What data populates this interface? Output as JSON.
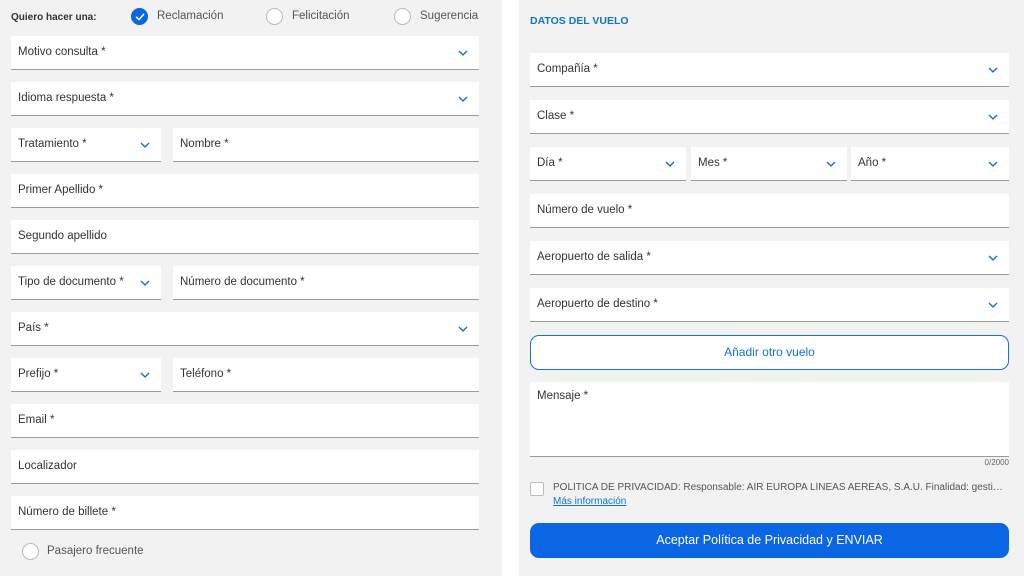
{
  "contact_type": {
    "question": "Quiero hacer una:",
    "options": [
      {
        "label": "Reclamación",
        "selected": true
      },
      {
        "label": "Felicitación",
        "selected": false
      },
      {
        "label": "Sugerencia",
        "selected": false
      }
    ]
  },
  "personal": {
    "motivo": "Motivo consulta *",
    "idioma": "Idioma respuesta *",
    "tratamiento": "Tratamiento *",
    "nombre": "Nombre *",
    "primer_apellido": "Primer Apellido *",
    "segundo_apellido": "Segundo apellido",
    "tipo_documento": "Tipo de documento *",
    "numero_documento": "Número de documento *",
    "pais": "País *",
    "prefijo": "Prefijo *",
    "telefono": "Teléfono *",
    "email": "Email *",
    "localizador": "Localizador",
    "numero_billete": "Número de billete *",
    "pasajero_frecuente": "Pasajero frecuente"
  },
  "flight": {
    "title": "DATOS DEL VUELO",
    "compania": "Compañía *",
    "clase": "Clase *",
    "dia": "Día *",
    "mes": "Mes *",
    "anio": "Año *",
    "numero_vuelo": "Número de vuelo *",
    "aeropuerto_salida": "Aeropuerto de salida *",
    "aeropuerto_destino": "Aeropuerto de destino *",
    "add_flight": "Añadir otro vuelo",
    "mensaje": "Mensaje *",
    "counter": "0/2000",
    "privacy_text": "POLÍTICA DE PRIVACIDAD: Responsable: AIR EUROPA LÍNEAS AÉREAS, S.A.U. Finalidad: gestionar...",
    "privacy_more": "Más información",
    "submit": "Aceptar Política de Privacidad y ENVIAR"
  },
  "colors": {
    "accent": "#0a66e4",
    "title_blue": "#1176c8",
    "panel_bg": "#f2f2f2"
  },
  "icons": {
    "dropdown": "chevron-down-icon",
    "radio_checked": "check-icon"
  }
}
